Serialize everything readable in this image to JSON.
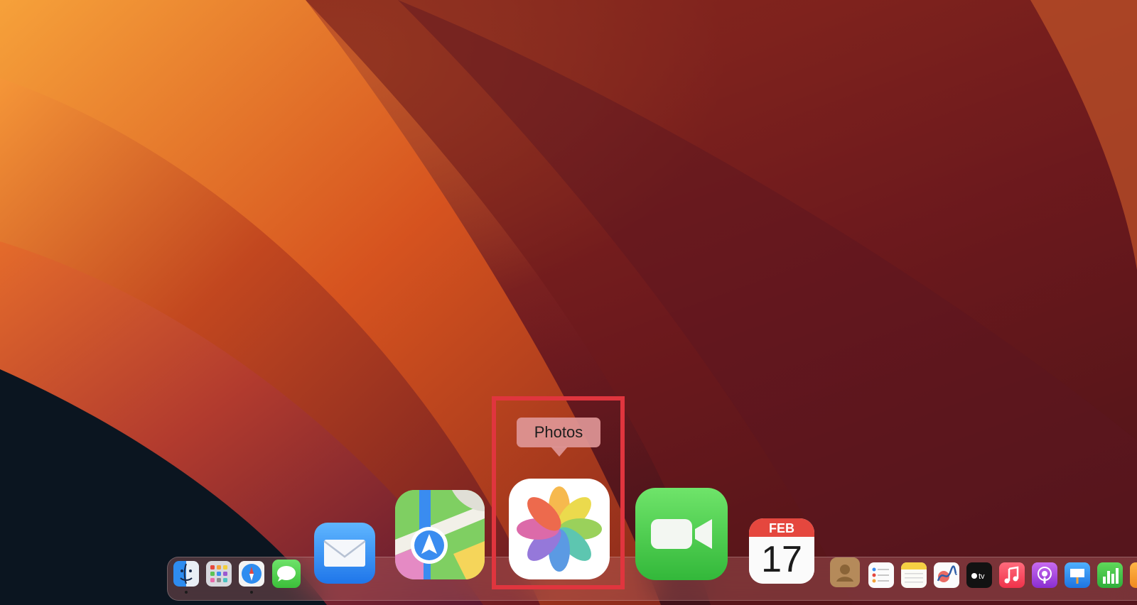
{
  "tooltip": {
    "label": "Photos"
  },
  "calendar": {
    "month": "FEB",
    "day": "17"
  },
  "highlight_color": "#e0353e",
  "dock": {
    "items": [
      {
        "name": "Finder",
        "icon": "finder-icon",
        "running": true
      },
      {
        "name": "Launchpad",
        "icon": "launchpad-icon",
        "running": false
      },
      {
        "name": "Safari",
        "icon": "safari-icon",
        "running": true
      },
      {
        "name": "Messages",
        "icon": "messages-icon",
        "running": false
      },
      {
        "name": "Mail",
        "icon": "mail-icon",
        "running": false
      },
      {
        "name": "Maps",
        "icon": "maps-icon",
        "running": false
      },
      {
        "name": "Photos",
        "icon": "photos-icon",
        "running": false
      },
      {
        "name": "FaceTime",
        "icon": "facetime-icon",
        "running": false
      },
      {
        "name": "Calendar",
        "icon": "calendar-icon",
        "running": false
      },
      {
        "name": "Contacts",
        "icon": "contacts-icon",
        "running": false
      },
      {
        "name": "Reminders",
        "icon": "reminders-icon",
        "running": false
      },
      {
        "name": "Notes",
        "icon": "notes-icon",
        "running": false
      },
      {
        "name": "Freeform",
        "icon": "freeform-icon",
        "running": false
      },
      {
        "name": "TV",
        "icon": "apple-tv-icon",
        "running": false
      },
      {
        "name": "Music",
        "icon": "music-icon",
        "running": false
      },
      {
        "name": "Podcasts",
        "icon": "podcasts-icon",
        "running": false
      },
      {
        "name": "Keynote",
        "icon": "keynote-icon",
        "running": false
      },
      {
        "name": "Numbers",
        "icon": "numbers-icon",
        "running": false
      },
      {
        "name": "Pages",
        "icon": "pages-icon",
        "running": false
      }
    ]
  }
}
